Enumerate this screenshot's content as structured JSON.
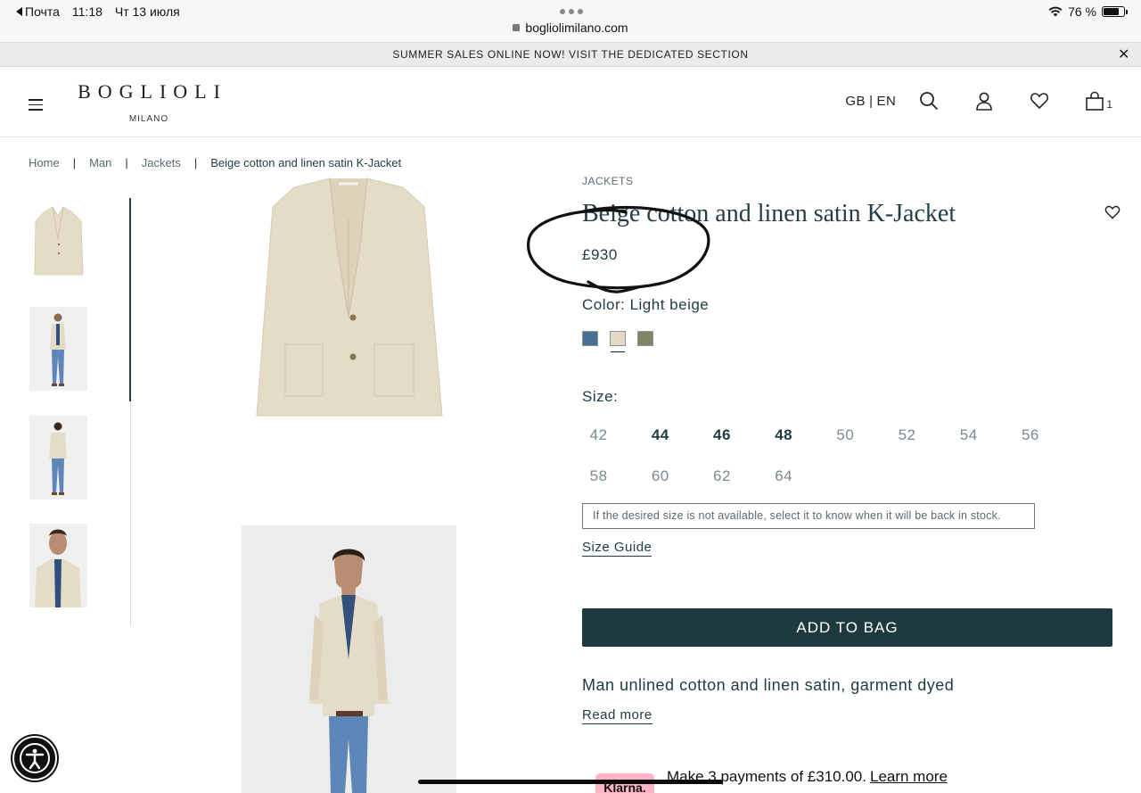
{
  "status_bar": {
    "back_app": "Почта",
    "time": "11:18",
    "date": "Чт 13 июля",
    "url": "bogliolimilano.com",
    "battery": "76 %",
    "battery_level": 0.76
  },
  "promo": {
    "text": "SUMMER SALES ONLINE NOW! VISIT THE DEDICATED SECTION",
    "close": "✕"
  },
  "header": {
    "logo_brand": "BOGLIOLI",
    "logo_sub": "MILANO",
    "country": "GB",
    "lang_sep": "|",
    "language": "EN",
    "bag_count": "1",
    "icons": [
      "menu-icon",
      "search-icon",
      "user-icon",
      "heart-icon",
      "bag-icon"
    ]
  },
  "breadcrumb": {
    "items": [
      "Home",
      "Man",
      "Jackets",
      "Beige cotton and linen satin K-Jacket"
    ],
    "separator": "|"
  },
  "product": {
    "category": "JACKETS",
    "title": "Beige cotton and linen satin K-Jacket",
    "price": "£930",
    "color_label": "Color: Light beige",
    "swatches": [
      {
        "name": "blue",
        "color": "#4a6f97"
      },
      {
        "name": "light-beige",
        "color": "#e3d9c5"
      },
      {
        "name": "olive",
        "color": "#7f8467"
      }
    ],
    "size_label": "Size:",
    "sizes": [
      {
        "value": "42",
        "available": false
      },
      {
        "value": "44",
        "available": true
      },
      {
        "value": "46",
        "available": true
      },
      {
        "value": "48",
        "available": true
      },
      {
        "value": "50",
        "available": false
      },
      {
        "value": "52",
        "available": false
      },
      {
        "value": "54",
        "available": false
      },
      {
        "value": "56",
        "available": false
      },
      {
        "value": "58",
        "available": false
      },
      {
        "value": "60",
        "available": false
      },
      {
        "value": "62",
        "available": false
      },
      {
        "value": "64",
        "available": false
      }
    ],
    "stock_note": "If the desired size is not available, select it to know when it will be back in stock.",
    "size_guide": "Size Guide",
    "add_to_bag": "ADD TO BAG",
    "description": "Man unlined cotton and linen satin, garment dyed",
    "read_more": "Read more",
    "klarna_logo": "Klarna.",
    "klarna_text": "Make 3 payments of £310.00.",
    "klarna_learn": "Learn more"
  },
  "colors": {
    "accent_dark": "#1e3a3e",
    "text": "#1f3b44",
    "jacket": "#e4dcc6",
    "klarna_pink": "#ffb3c7"
  }
}
